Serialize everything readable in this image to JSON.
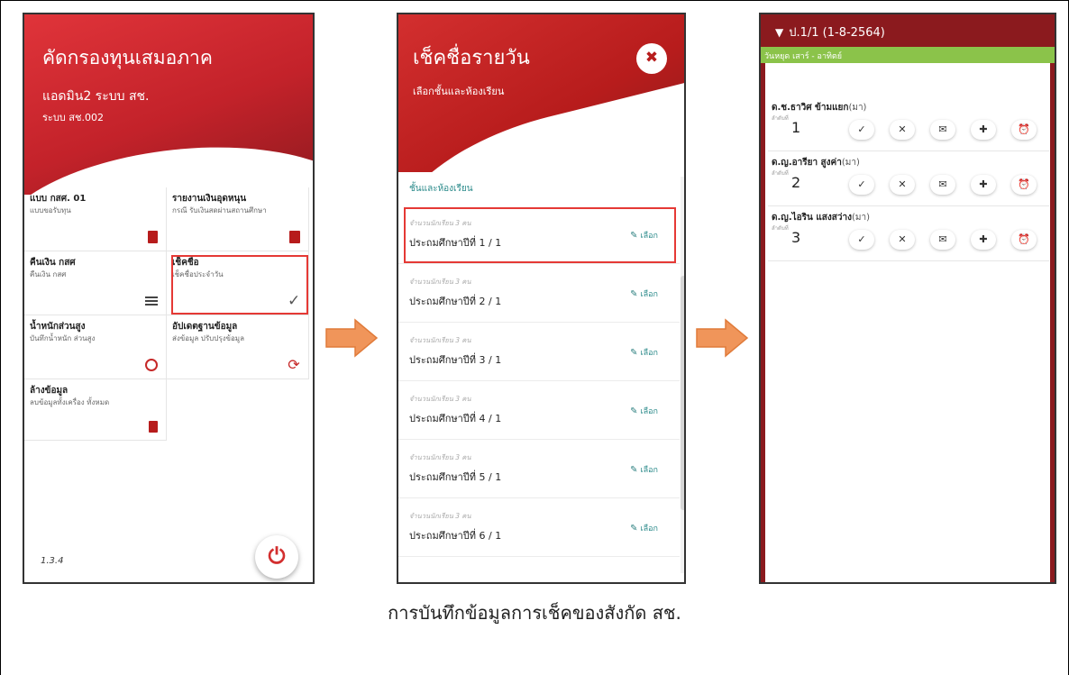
{
  "phone1": {
    "title": "คัดกรองทุนเสมอภาค",
    "user": "แอดมิน2 ระบบ สช.",
    "system": "ระบบ สช.002",
    "menu": [
      {
        "title": "แบบ กสศ. 01",
        "sub": "แบบขอรับทุน",
        "icon": "document-icon"
      },
      {
        "title": "รายงานเงินอุดหนุน",
        "sub": "กรณี รับเงินสดผ่านสถานศึกษา",
        "icon": "clipboard-icon"
      },
      {
        "title": "คืนเงิน กสศ",
        "sub": "คืนเงิน กสศ",
        "icon": "list-icon"
      },
      {
        "title": "เช็คชื่อ",
        "sub": "เช็คชื่อประจำวัน",
        "icon": "check-icon"
      },
      {
        "title": "น้ำหนักส่วนสูง",
        "sub": "บันทึกน้ำหนัก ส่วนสูง",
        "icon": "timer-icon"
      },
      {
        "title": "อัปเดตฐานข้อมูล",
        "sub": "ส่งข้อมูล ปรับปรุงข้อมูล",
        "icon": "sync-icon"
      },
      {
        "title": "ล้างข้อมูล",
        "sub": "ลบข้อมูลทั้งเครื่อง ทั้งหมด",
        "icon": "trash-icon"
      }
    ],
    "version": "1.3.4",
    "power_glyph": "⏻"
  },
  "phone2": {
    "title": "เช็คชื่อรายวัน",
    "subtitle": "เลือกชั้นและห้องเรียน",
    "close_glyph": "✖",
    "section_label": "ชั้นและห้องเรียน",
    "pick_label": "เลือก",
    "rooms": [
      {
        "count": "จำนวนนักเรียน 3 คน",
        "name": "ประถมศึกษาปีที่ 1 / 1"
      },
      {
        "count": "จำนวนนักเรียน 3 คน",
        "name": "ประถมศึกษาปีที่ 2 / 1"
      },
      {
        "count": "จำนวนนักเรียน 3 คน",
        "name": "ประถมศึกษาปีที่ 3 / 1"
      },
      {
        "count": "จำนวนนักเรียน 3 คน",
        "name": "ประถมศึกษาปีที่ 4 / 1"
      },
      {
        "count": "จำนวนนักเรียน 3 คน",
        "name": "ประถมศึกษาปีที่ 5 / 1"
      },
      {
        "count": "จำนวนนักเรียน 3 คน",
        "name": "ประถมศึกษาปีที่ 6 / 1"
      }
    ]
  },
  "phone3": {
    "header": "ป.1/1 (1-8-2564)",
    "holiday": "วันหยุด เสาร์ - อาทิตย์",
    "order_label": "ลำดับที่",
    "students": [
      {
        "name": "ด.ช.ธาวิศ ข้ามแยก",
        "status": "(มา)",
        "order": "1"
      },
      {
        "name": "ด.ญ.อารียา สูงค่า",
        "status": "(มา)",
        "order": "2"
      },
      {
        "name": "ด.ญ.ไอริน แสงสว่าง",
        "status": "(มา)",
        "order": "3"
      }
    ],
    "buttons": [
      {
        "name": "present-button",
        "glyph": "✓"
      },
      {
        "name": "absent-button",
        "glyph": "✕"
      },
      {
        "name": "leave-button",
        "glyph": "✉"
      },
      {
        "name": "sick-button",
        "glyph": "✚"
      },
      {
        "name": "late-button",
        "glyph": "⏰"
      }
    ]
  },
  "caption": "การบันทึกข้อมูลการเช็คของสังกัด สช.",
  "colors": {
    "brand_red": "#c3222a",
    "dark_red": "#8b1a1e",
    "teal": "#2a8a8a",
    "green": "#8bc34a",
    "arrow": "#f0955a"
  }
}
